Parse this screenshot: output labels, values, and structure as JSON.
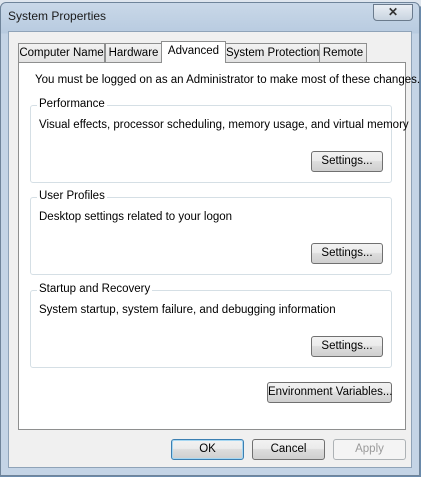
{
  "window": {
    "title": "System Properties",
    "close_label": "✕"
  },
  "tabs": [
    {
      "label": "Computer Name",
      "active": false
    },
    {
      "label": "Hardware",
      "active": false
    },
    {
      "label": "Advanced",
      "active": true
    },
    {
      "label": "System Protection",
      "active": false
    },
    {
      "label": "Remote",
      "active": false
    }
  ],
  "advanced": {
    "intro": "You must be logged on as an Administrator to make most of these changes.",
    "performance": {
      "title": "Performance",
      "description": "Visual effects, processor scheduling, memory usage, and virtual memory",
      "button": "Settings..."
    },
    "user_profiles": {
      "title": "User Profiles",
      "description": "Desktop settings related to your logon",
      "button": "Settings..."
    },
    "startup_recovery": {
      "title": "Startup and Recovery",
      "description": "System startup, system failure, and debugging information",
      "button": "Settings..."
    },
    "env_button": "Environment Variables..."
  },
  "footer": {
    "ok": "OK",
    "cancel": "Cancel",
    "apply": "Apply"
  }
}
